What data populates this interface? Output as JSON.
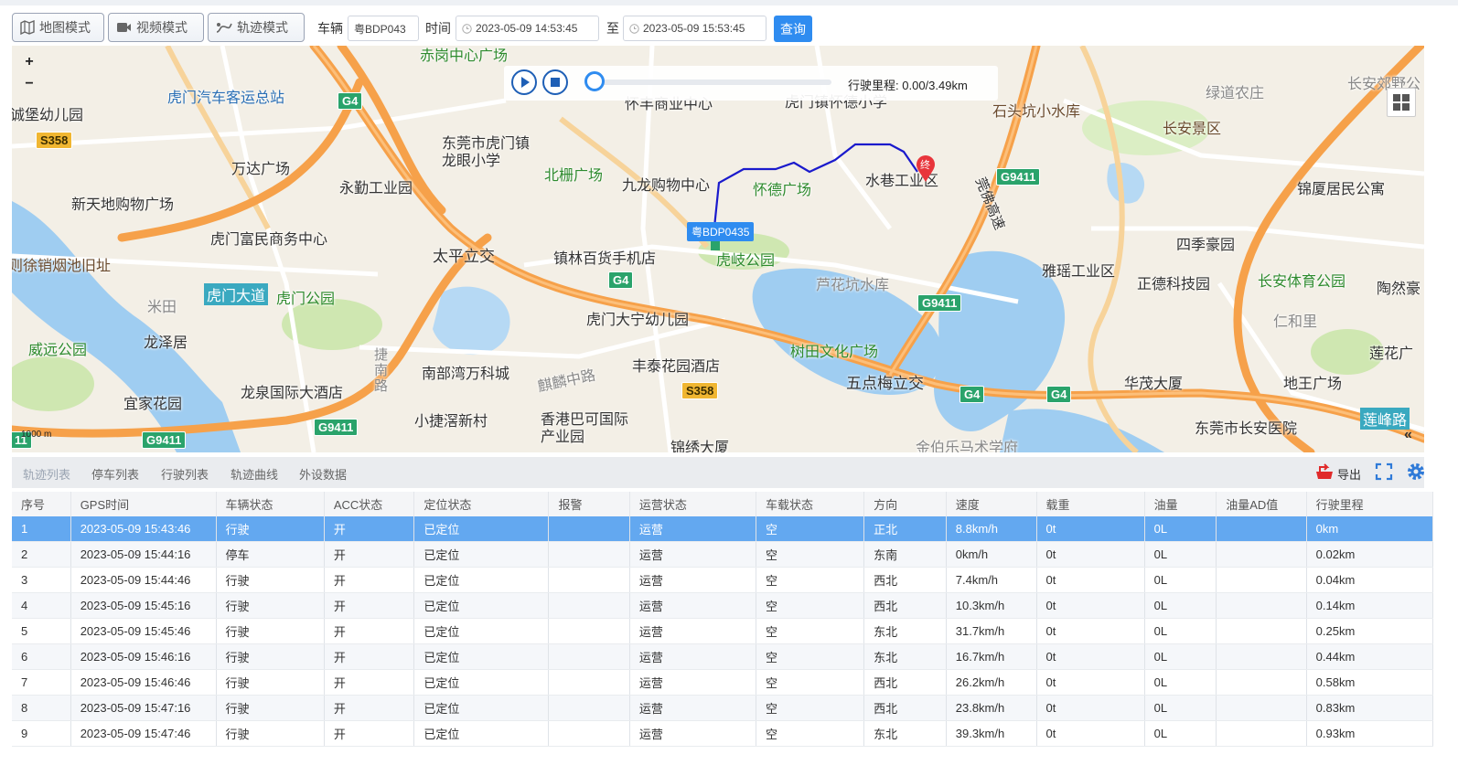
{
  "toolbar": {
    "map_mode": "地图模式",
    "video_mode": "视频模式",
    "track_mode": "轨迹模式",
    "vehicle_label": "车辆",
    "vehicle_value": "粤BDP043",
    "time_label": "时间",
    "start_time": "2023-05-09 14:53:45",
    "to_label": "至",
    "end_time": "2023-05-09 15:53:45",
    "query": "查询"
  },
  "map": {
    "zoom_in": "+",
    "zoom_out": "−",
    "mileage_label": "行驶里程:",
    "mileage_value": "0.00/3.49km",
    "vehicle_tag": "粤BDP0435",
    "end_marker": "终",
    "scale": "1000 m",
    "collapse": "«",
    "labels": {
      "chigang": "赤岗中心广场",
      "huaifeng": "怀丰商业中心",
      "huaide_school": "虎门镇怀德小学",
      "shitoukeng": "石头坑小水库",
      "lvdao": "绿道农庄",
      "changan_jiaoye": "长安郊野公",
      "humen_bus": "虎门汽车客运总站",
      "youeryuan": "诚堡幼儿园",
      "dongguan_school": "东莞市虎门镇龙眼小学",
      "beizha": "北栅广场",
      "changan_jingqu": "长安景区",
      "wanda": "万达广场",
      "yongqin": "永勤工业园",
      "jiulong": "九龙购物中心",
      "huaide_sq": "怀德广场",
      "shuixiang": "水巷工业区",
      "xintiandi": "新天地购物广场",
      "jinxia": "锦厦居民公寓",
      "fumin": "虎门富民商务中心",
      "taiping": "太平立交",
      "zhenlin": "镇林百货手机店",
      "huaqi": "虎岐公园",
      "siji": "四季豪园",
      "yantai": "则徐销烟池旧址",
      "luhuakeng": "芦花坑水库",
      "yayao": "雅瑶工业区",
      "zhengde": "正德科技园",
      "changan_sports": "长安体育公园",
      "taoran": "陶然豪",
      "humen_dadao": "虎门大道",
      "humen_park": "虎门公园",
      "mitian": "米田",
      "daning": "虎门大宁幼儿园",
      "renhe": "仁和里",
      "weiyuan": "威远公园",
      "longze": "龙泽居",
      "shutian": "树田文化广场",
      "lianhua": "莲花广",
      "nanbuwan": "南部湾万科城",
      "fengtai": "丰泰花园酒店",
      "qilin": "麒麟中路",
      "wudianmei": "五点梅立交",
      "huamao": "华茂大厦",
      "diwang": "地王广场",
      "yijia": "宜家花园",
      "longquan": "龙泉国际大酒店",
      "jienan": "捷南路",
      "xiaojie": "小捷滘新村",
      "xianggang": "香港巴可国际产业园",
      "jinxiu": "锦绣大厦",
      "jinbole": "金伯乐马术学府",
      "changan_hospital": "东莞市长安医院",
      "lianfeng": "莲峰路"
    },
    "shields": {
      "g4_a": "G4",
      "s358_a": "S358",
      "g9411_a": "G9411",
      "g4_b": "G4",
      "g9411_b": "G9411",
      "g4_c": "G4",
      "g4_d": "G4",
      "s358_b": "S358",
      "g9411_c": "G9411",
      "g9411_d": "G9411",
      "g9411_e": "11"
    },
    "expressway_label": "莞佛高速"
  },
  "tabs": {
    "items": [
      "轨迹列表",
      "停车列表",
      "行驶列表",
      "轨迹曲线",
      "外设数据"
    ],
    "export": "导出"
  },
  "table": {
    "headers": [
      "序号",
      "GPS时间",
      "车辆状态",
      "ACC状态",
      "定位状态",
      "报警",
      "运营状态",
      "车载状态",
      "方向",
      "速度",
      "载重",
      "油量",
      "油量AD值",
      "行驶里程"
    ],
    "rows": [
      [
        "1",
        "2023-05-09 15:43:46",
        "行驶",
        "开",
        "已定位",
        "",
        "运营",
        "空",
        "正北",
        "8.8km/h",
        "0t",
        "0L",
        "",
        "0km"
      ],
      [
        "2",
        "2023-05-09 15:44:16",
        "停车",
        "开",
        "已定位",
        "",
        "运营",
        "空",
        "东南",
        "0km/h",
        "0t",
        "0L",
        "",
        "0.02km"
      ],
      [
        "3",
        "2023-05-09 15:44:46",
        "行驶",
        "开",
        "已定位",
        "",
        "运营",
        "空",
        "西北",
        "7.4km/h",
        "0t",
        "0L",
        "",
        "0.04km"
      ],
      [
        "4",
        "2023-05-09 15:45:16",
        "行驶",
        "开",
        "已定位",
        "",
        "运营",
        "空",
        "西北",
        "10.3km/h",
        "0t",
        "0L",
        "",
        "0.14km"
      ],
      [
        "5",
        "2023-05-09 15:45:46",
        "行驶",
        "开",
        "已定位",
        "",
        "运营",
        "空",
        "东北",
        "31.7km/h",
        "0t",
        "0L",
        "",
        "0.25km"
      ],
      [
        "6",
        "2023-05-09 15:46:16",
        "行驶",
        "开",
        "已定位",
        "",
        "运营",
        "空",
        "东北",
        "16.7km/h",
        "0t",
        "0L",
        "",
        "0.44km"
      ],
      [
        "7",
        "2023-05-09 15:46:46",
        "行驶",
        "开",
        "已定位",
        "",
        "运营",
        "空",
        "西北",
        "26.2km/h",
        "0t",
        "0L",
        "",
        "0.58km"
      ],
      [
        "8",
        "2023-05-09 15:47:16",
        "行驶",
        "开",
        "已定位",
        "",
        "运营",
        "空",
        "西北",
        "23.8km/h",
        "0t",
        "0L",
        "",
        "0.83km"
      ],
      [
        "9",
        "2023-05-09 15:47:46",
        "行驶",
        "开",
        "已定位",
        "",
        "运营",
        "空",
        "东北",
        "39.3km/h",
        "0t",
        "0L",
        "",
        "0.93km"
      ]
    ]
  },
  "colors": {
    "accent": "#2f8cf0",
    "selected_row": "#63a8f0",
    "expressway": "#f5a04a",
    "water": "#8ec3ee",
    "park": "#c8e6a9",
    "track": "#1a1acc"
  }
}
